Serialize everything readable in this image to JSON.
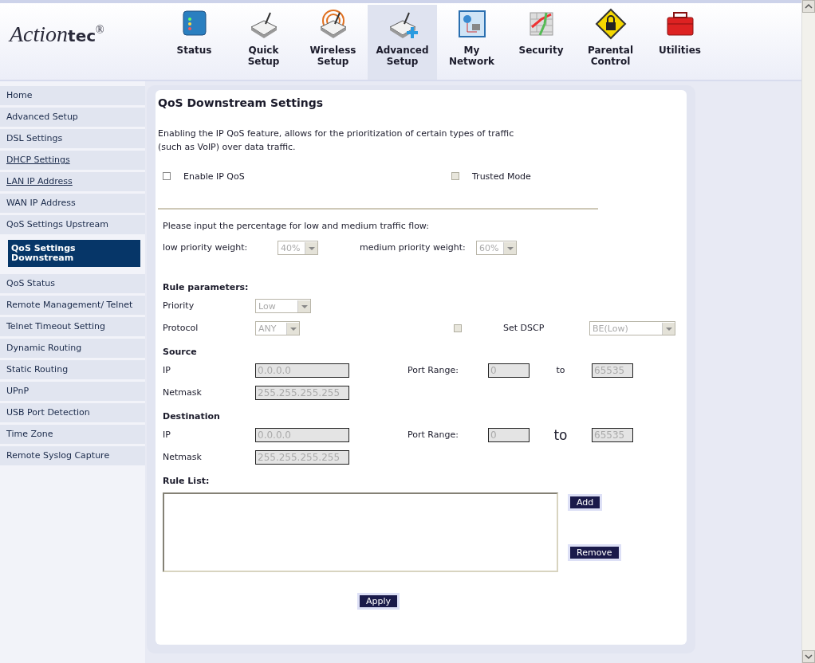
{
  "logo": {
    "script": "Action",
    "bold": "tec",
    "mark": "®"
  },
  "nav": [
    {
      "label": "Status",
      "kind": "monitor",
      "selected": false
    },
    {
      "label": "Quick Setup",
      "kind": "router",
      "selected": false
    },
    {
      "label": "Wireless Setup",
      "kind": "wireless",
      "selected": false
    },
    {
      "label": "Advanced Setup",
      "kind": "router-plus",
      "selected": true
    },
    {
      "label": "My Network",
      "kind": "network",
      "selected": false
    },
    {
      "label": "Security",
      "kind": "wall",
      "selected": false
    },
    {
      "label": "Parental Control",
      "kind": "lock",
      "selected": false
    },
    {
      "label": "Utilities",
      "kind": "toolbox",
      "selected": false
    }
  ],
  "sidebar": [
    {
      "label": "Home",
      "selected": false,
      "visited": false
    },
    {
      "label": "Advanced Setup",
      "selected": false,
      "visited": false
    },
    {
      "label": "DSL Settings",
      "selected": false,
      "visited": false
    },
    {
      "label": "DHCP Settings",
      "selected": false,
      "visited": true
    },
    {
      "label": "LAN IP Address",
      "selected": false,
      "visited": true
    },
    {
      "label": "WAN IP Address",
      "selected": false,
      "visited": false
    },
    {
      "label": "QoS Settings Upstream",
      "selected": false,
      "visited": false
    },
    {
      "label": "QoS Settings Downstream",
      "selected": true,
      "visited": false
    },
    {
      "label": "QoS Status",
      "selected": false,
      "visited": false
    },
    {
      "label": "Remote Management/ Telnet",
      "selected": false,
      "visited": false
    },
    {
      "label": "Telnet Timeout Setting",
      "selected": false,
      "visited": false
    },
    {
      "label": "Dynamic Routing",
      "selected": false,
      "visited": false
    },
    {
      "label": "Static Routing",
      "selected": false,
      "visited": false
    },
    {
      "label": "UPnP",
      "selected": false,
      "visited": false
    },
    {
      "label": "USB Port Detection",
      "selected": false,
      "visited": false
    },
    {
      "label": "Time Zone",
      "selected": false,
      "visited": false
    },
    {
      "label": "Remote Syslog Capture",
      "selected": false,
      "visited": false
    }
  ],
  "panel": {
    "title": "QoS Downstream Settings",
    "intro": "Enabling the IP QoS feature, allows for the prioritization of certain types of traffic (such as VoIP) over data traffic.",
    "enable_ip_qos": {
      "label": "Enable IP QoS",
      "checked": false,
      "disabled": false
    },
    "trusted_mode": {
      "label": "Trusted Mode",
      "checked": false,
      "disabled": true
    },
    "weights": {
      "prompt": "Please input the percentage for low and medium traffic flow:",
      "low": {
        "label": "low priority weight:",
        "value": "40%",
        "disabled": true
      },
      "medium": {
        "label": "medium priority weight:",
        "value": "60%",
        "disabled": true
      }
    },
    "rule": {
      "heading": "Rule parameters:",
      "priority": {
        "label": "Priority",
        "value": "Low",
        "disabled": true
      },
      "protocol": {
        "label": "Protocol",
        "value": "ANY",
        "disabled": true
      },
      "dscp": {
        "label": "Set DSCP",
        "checked": false,
        "disabled": true,
        "value": "BE(Low)"
      },
      "endpoints": [
        {
          "heading": "Source",
          "ip": {
            "label": "IP",
            "value": "0.0.0.0",
            "disabled": true
          },
          "netmask": {
            "label": "Netmask",
            "value": "255.255.255.255",
            "disabled": true
          },
          "port": {
            "label": "Port Range:",
            "from": "0",
            "to_label": "to",
            "to": "65535",
            "disabled": true
          }
        },
        {
          "heading": "Destination",
          "ip": {
            "label": "IP",
            "value": "0.0.0.0",
            "disabled": true
          },
          "netmask": {
            "label": "Netmask",
            "value": "255.255.255.255",
            "disabled": true
          },
          "port": {
            "label": "Port Range:",
            "from": "0",
            "to_label": "to",
            "to": "65535",
            "disabled": true
          }
        }
      ]
    },
    "rule_list": {
      "heading": "Rule List:",
      "add": "Add",
      "remove": "Remove"
    },
    "apply": "Apply"
  }
}
